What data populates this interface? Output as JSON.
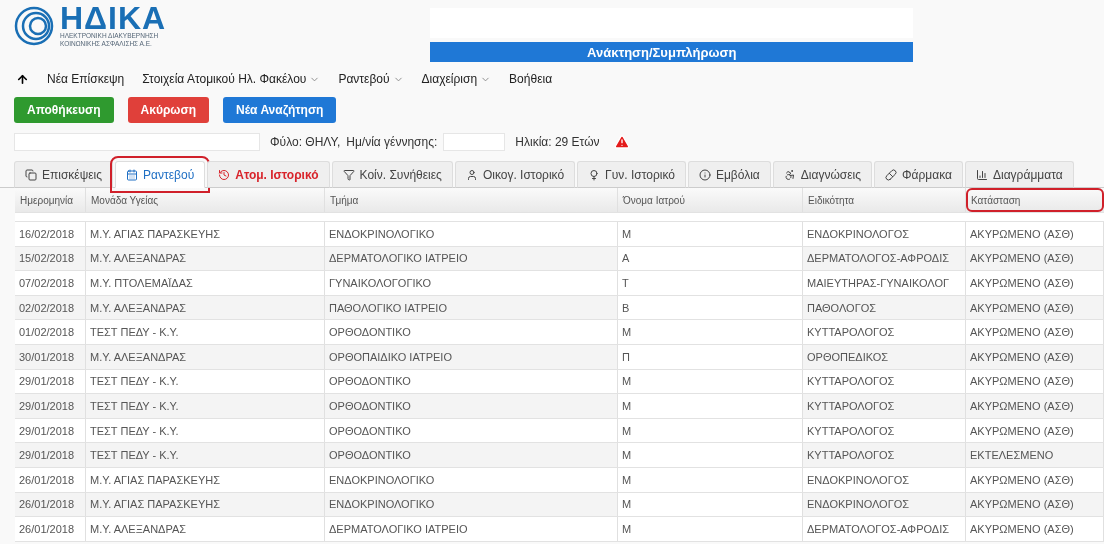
{
  "logo": {
    "name": "ΗΔΙΚΑ",
    "subtitle_1": "ΗΛΕΚΤΡΟΝΙΚΗ ΔΙΑΚΥΒΕΡΝΗΣΗ",
    "subtitle_2": "ΚΟΙΝΩΝΙΚΗΣ ΑΣΦΑΛΙΣΗΣ Α.Ε."
  },
  "title_bar": {
    "title": "Ανάκτηση/Συμπλήρωση"
  },
  "nav": [
    {
      "label": "Νέα Επίσκεψη",
      "dropdown": false
    },
    {
      "label": "Στοιχεία Ατομικού Ηλ. Φακέλου",
      "dropdown": true
    },
    {
      "label": "Ραντεβού",
      "dropdown": true
    },
    {
      "label": "Διαχείριση",
      "dropdown": true
    },
    {
      "label": "Βοήθεια",
      "dropdown": false
    }
  ],
  "buttons": [
    {
      "label": "Αποθήκευση",
      "kind": "success"
    },
    {
      "label": "Ακύρωση",
      "kind": "danger"
    },
    {
      "label": "Νέα Αναζήτηση",
      "kind": "primary"
    }
  ],
  "patient": {
    "sex": "Φύλο: ΘΗΛΥ,",
    "birth_label": "Ημ/νία γέννησης:",
    "age": "Ηλικία: 29 Ετών",
    "warning": true
  },
  "tabs": [
    {
      "label": "Επισκέψεις",
      "selected": false,
      "alert": false,
      "circled": false
    },
    {
      "label": "Ραντεβού",
      "selected": true,
      "alert": false,
      "circled": true
    },
    {
      "label": "Ατομ. Ιστορικό",
      "selected": false,
      "alert": true,
      "circled": false
    },
    {
      "label": "Κοίν. Συνήθειες",
      "selected": false,
      "alert": false,
      "circled": false
    },
    {
      "label": "Οικογ. Ιστορικό",
      "selected": false,
      "alert": false,
      "circled": false
    },
    {
      "label": "Γυν. Ιστορικό",
      "selected": false,
      "alert": false,
      "circled": false
    },
    {
      "label": "Εμβόλια",
      "selected": false,
      "alert": false,
      "circled": false
    },
    {
      "label": "Διαγνώσεις",
      "selected": false,
      "alert": false,
      "circled": false
    },
    {
      "label": "Φάρμακα",
      "selected": false,
      "alert": false,
      "circled": false
    },
    {
      "label": "Διαγράμματα",
      "selected": false,
      "alert": false,
      "circled": false
    }
  ],
  "table": {
    "columns": [
      {
        "label": "Ημερομηνία",
        "circled": false
      },
      {
        "label": "Μονάδα Υγείας",
        "circled": false
      },
      {
        "label": "Τμήμα",
        "circled": false
      },
      {
        "label": "Όνομα Ιατρού",
        "circled": false
      },
      {
        "label": "Ειδικότητα",
        "circled": false
      },
      {
        "label": "Κατάσταση",
        "circled": true
      }
    ],
    "rows": [
      [
        "16/02/2018",
        "Μ.Υ. ΑΓΙΑΣ ΠΑΡΑΣΚΕΥΗΣ",
        "ΕΝΔΟΚΡΙΝΟΛΟΓΙΚΟ",
        "Μ",
        "ΕΝΔΟΚΡΙΝΟΛΟΓΟΣ",
        "ΑΚΥΡΩΜΕΝΟ (ΑΣΘ)"
      ],
      [
        "15/02/2018",
        "Μ.Υ. ΑΛΕΞΑΝΔΡΑΣ",
        "ΔΕΡΜΑΤΟΛΟΓΙΚΟ ΙΑΤΡΕΙΟ",
        "Α",
        "ΔΕΡΜΑΤΟΛΟΓΟΣ-ΑΦΡΟΔΙΣ",
        "ΑΚΥΡΩΜΕΝΟ (ΑΣΘ)"
      ],
      [
        "07/02/2018",
        "Μ.Υ. ΠΤΟΛΕΜΑΪΔΑΣ",
        "ΓΥΝΑΙΚΟΛΟΓΟΓΙΚΟ",
        "Τ",
        "ΜΑΙΕΥΤΗΡΑΣ-ΓΥΝΑΙΚΟΛΟΓ",
        "ΑΚΥΡΩΜΕΝΟ (ΑΣΘ)"
      ],
      [
        "02/02/2018",
        "Μ.Υ. ΑΛΕΞΑΝΔΡΑΣ",
        "ΠΑΘΟΛΟΓΙΚΟ ΙΑΤΡΕΙΟ",
        "Β",
        "ΠΑΘΟΛΟΓΟΣ",
        "ΑΚΥΡΩΜΕΝΟ (ΑΣΘ)"
      ],
      [
        "01/02/2018",
        "ΤΕΣΤ ΠΕΔΥ - Κ.Υ.",
        "ΟΡΘΟΔΟΝΤΙΚΟ",
        "Μ",
        "ΚΥΤΤΑΡΟΛΟΓΟΣ",
        "ΑΚΥΡΩΜΕΝΟ (ΑΣΘ)"
      ],
      [
        "30/01/2018",
        "Μ.Υ. ΑΛΕΞΑΝΔΡΑΣ",
        "ΟΡΘΟΠΑΙΔΙΚΟ ΙΑΤΡΕΙΟ",
        "Π",
        "ΟΡΘΟΠΕΔΙΚΟΣ",
        "ΑΚΥΡΩΜΕΝΟ (ΑΣΘ)"
      ],
      [
        "29/01/2018",
        "ΤΕΣΤ ΠΕΔΥ - Κ.Υ.",
        "ΟΡΘΟΔΟΝΤΙΚΟ",
        "Μ",
        "ΚΥΤΤΑΡΟΛΟΓΟΣ",
        "ΑΚΥΡΩΜΕΝΟ (ΑΣΘ)"
      ],
      [
        "29/01/2018",
        "ΤΕΣΤ ΠΕΔΥ - Κ.Υ.",
        "ΟΡΘΟΔΟΝΤΙΚΟ",
        "Μ",
        "ΚΥΤΤΑΡΟΛΟΓΟΣ",
        "ΑΚΥΡΩΜΕΝΟ (ΑΣΘ)"
      ],
      [
        "29/01/2018",
        "ΤΕΣΤ ΠΕΔΥ - Κ.Υ.",
        "ΟΡΘΟΔΟΝΤΙΚΟ",
        "Μ",
        "ΚΥΤΤΑΡΟΛΟΓΟΣ",
        "ΑΚΥΡΩΜΕΝΟ (ΑΣΘ)"
      ],
      [
        "29/01/2018",
        "ΤΕΣΤ ΠΕΔΥ - Κ.Υ.",
        "ΟΡΘΟΔΟΝΤΙΚΟ",
        "Μ",
        "ΚΥΤΤΑΡΟΛΟΓΟΣ",
        "ΕΚΤΕΛΕΣΜΕΝΟ"
      ],
      [
        "26/01/2018",
        "Μ.Υ. ΑΓΙΑΣ ΠΑΡΑΣΚΕΥΗΣ",
        "ΕΝΔΟΚΡΙΝΟΛΟΓΙΚΟ",
        "Μ",
        "ΕΝΔΟΚΡΙΝΟΛΟΓΟΣ",
        "ΑΚΥΡΩΜΕΝΟ (ΑΣΘ)"
      ],
      [
        "26/01/2018",
        "Μ.Υ. ΑΓΙΑΣ ΠΑΡΑΣΚΕΥΗΣ",
        "ΕΝΔΟΚΡΙΝΟΛΟΓΙΚΟ",
        "Μ",
        "ΕΝΔΟΚΡΙΝΟΛΟΓΟΣ",
        "ΑΚΥΡΩΜΕΝΟ (ΑΣΘ)"
      ],
      [
        "26/01/2018",
        "Μ.Υ. ΑΛΕΞΑΝΔΡΑΣ",
        "ΔΕΡΜΑΤΟΛΟΓΙΚΟ ΙΑΤΡΕΙΟ",
        "Μ",
        "ΔΕΡΜΑΤΟΛΟΓΟΣ-ΑΦΡΟΔΙΣ",
        "ΑΚΥΡΩΜΕΝΟ (ΑΣΘ)"
      ]
    ]
  }
}
